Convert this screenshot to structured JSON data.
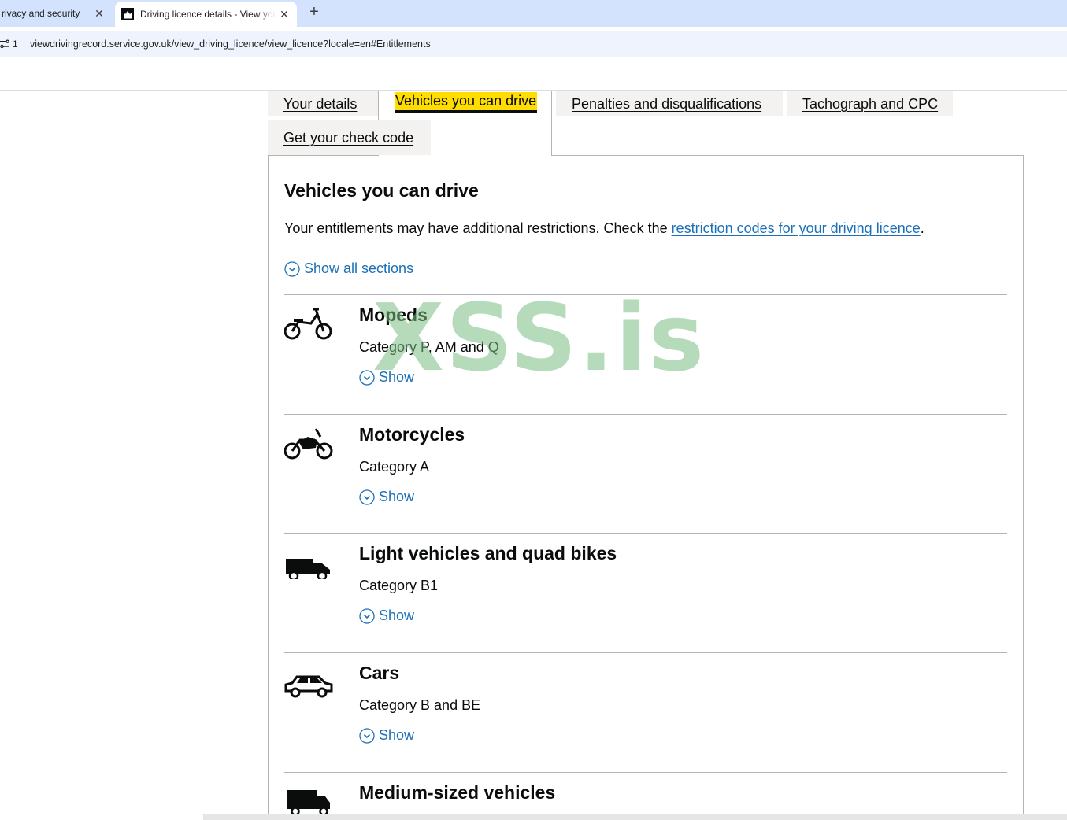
{
  "browser": {
    "tabs": [
      {
        "title": "rivacy and security",
        "active": false
      },
      {
        "title": "Driving licence details - View your driving licence",
        "active": true
      }
    ],
    "close_glyph": "✕",
    "new_tab_glyph": "+",
    "site_info_count": "1",
    "url": "viewdrivingrecord.service.gov.uk/view_driving_licence/view_licence?locale=en#Entitlements"
  },
  "gov_tabs": {
    "your_details": "Your details",
    "vehicles": "Vehicles you can drive",
    "penalties": "Penalties and disqualifications",
    "tachograph": "Tachograph and CPC",
    "check_code": "Get your check code"
  },
  "panel": {
    "heading": "Vehicles you can drive",
    "intro_text": "Your entitlements may have additional restrictions. Check the ",
    "intro_link": "restriction codes for your driving licence",
    "intro_end": ".",
    "show_all": "Show all sections"
  },
  "sections": [
    {
      "title": "Mopeds",
      "category": "Category P, AM and Q",
      "show": "Show",
      "icon": "moped-icon"
    },
    {
      "title": "Motorcycles",
      "category": "Category A",
      "show": "Show",
      "icon": "motorcycle-icon"
    },
    {
      "title": "Light vehicles and quad bikes",
      "category": "Category B1",
      "show": "Show",
      "icon": "light-vehicle-icon"
    },
    {
      "title": "Cars",
      "category": "Category B and BE",
      "show": "Show",
      "icon": "car-icon"
    },
    {
      "title": "Medium-sized vehicles",
      "category": "",
      "show": "",
      "icon": "medium-vehicle-icon"
    }
  ],
  "watermark": "XSS.is",
  "colors": {
    "link": "#1d70b8",
    "focus": "#ffdd00",
    "tab_bg": "#f3f2f1",
    "border": "#b1b4b6"
  }
}
